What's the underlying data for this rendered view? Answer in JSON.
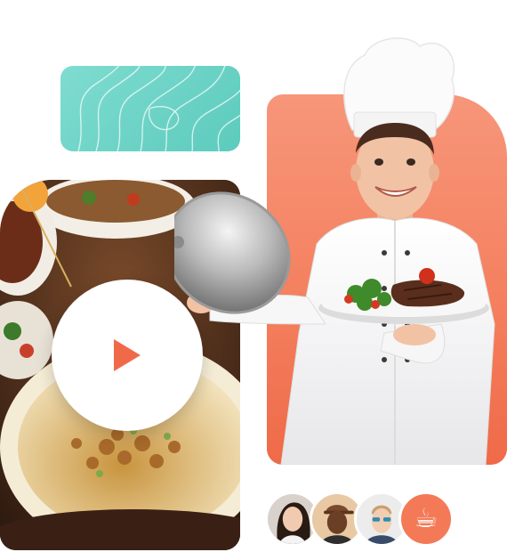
{
  "colors": {
    "teal": "#6dd4c7",
    "orange": "#f4805f",
    "accent": "#f06a4a",
    "white": "#ffffff"
  },
  "hero": {
    "decorative_card": {
      "icon": "topo-lines-icon"
    },
    "video": {
      "play_icon": "play-icon",
      "image": "food-photo"
    },
    "chef": {
      "image": "chef-photo"
    }
  },
  "testimonials": {
    "avatars": [
      {
        "icon": "avatar-woman"
      },
      {
        "icon": "avatar-man-cap"
      },
      {
        "icon": "avatar-man-glasses"
      }
    ],
    "badge": {
      "icon": "coffee-cup-icon",
      "glyph": "☕"
    }
  }
}
